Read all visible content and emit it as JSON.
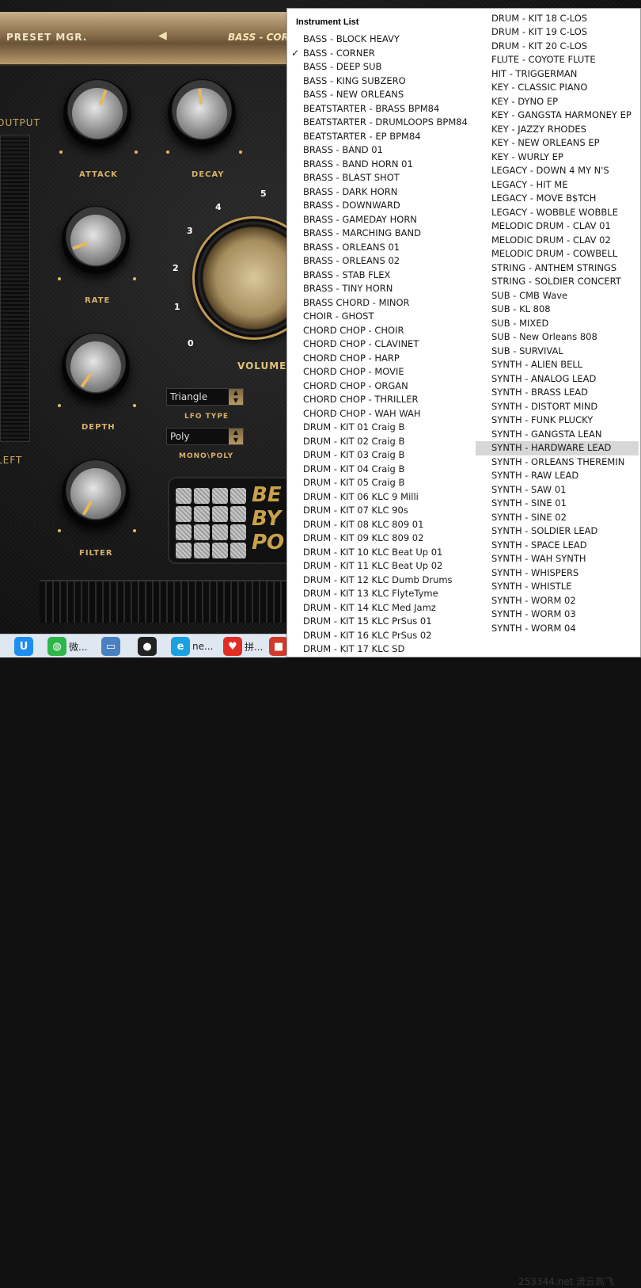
{
  "plugin": {
    "preset_manager_label": "PRESET MGR.",
    "preset_name": "BASS - CORNER",
    "output_label": "OUTPUT",
    "left_label": "LEFT",
    "knobs": [
      {
        "id": "attack",
        "label": "ATTACK"
      },
      {
        "id": "decay",
        "label": "DECAY"
      },
      {
        "id": "rate",
        "label": "RATE"
      },
      {
        "id": "depth",
        "label": "DEPTH"
      },
      {
        "id": "filter",
        "label": "FILTER"
      }
    ],
    "volume": {
      "label": "VOLUME",
      "scale": [
        "0",
        "1",
        "2",
        "3",
        "4",
        "5"
      ]
    },
    "lfo_type": {
      "label": "LFO TYPE",
      "value": "Triangle"
    },
    "mono_poly": {
      "label": "MONO\\POLY",
      "value": "Poly"
    },
    "logo_text": [
      "BE",
      "BY",
      "PO"
    ]
  },
  "menu": {
    "title": "Instrument List",
    "checked_item": "BASS - CORNER",
    "highlighted_item": "SYNTH - HARDWARE LEAD",
    "left_column": [
      "BASS - BLOCK HEAVY",
      "BASS - CORNER",
      "BASS - DEEP SUB",
      "BASS - KING SUBZERO",
      "BASS - NEW ORLEANS",
      "BEATSTARTER - BRASS BPM84",
      "BEATSTARTER - DRUMLOOPS BPM84",
      "BEATSTARTER - EP BPM84",
      "BRASS - BAND 01",
      "BRASS - BAND HORN 01",
      "BRASS - BLAST SHOT",
      "BRASS - DARK HORN",
      "BRASS - DOWNWARD",
      "BRASS - GAMEDAY HORN",
      "BRASS - MARCHING BAND",
      "BRASS - ORLEANS 01",
      "BRASS - ORLEANS 02",
      "BRASS - STAB FLEX",
      "BRASS - TINY HORN",
      "BRASS CHORD - MINOR",
      "CHOIR - GHOST",
      "CHORD CHOP - CHOIR",
      "CHORD CHOP - CLAVINET",
      "CHORD CHOP - HARP",
      "CHORD CHOP - MOVIE",
      "CHORD CHOP - ORGAN",
      "CHORD CHOP - THRILLER",
      "CHORD CHOP - WAH WAH",
      "DRUM - KIT 01 Craig B",
      "DRUM - KIT 02 Craig B",
      "DRUM - KIT 03 Craig B",
      "DRUM - KIT 04 Craig B",
      "DRUM - KIT 05 Craig B",
      "DRUM - KIT 06 KLC 9 Milli",
      "DRUM - KIT 07 KLC 90s",
      "DRUM - KIT 08 KLC 809 01",
      "DRUM - KIT 09 KLC 809 02",
      "DRUM - KIT 10 KLC Beat Up 01",
      "DRUM - KIT 11 KLC Beat Up 02",
      "DRUM - KIT 12 KLC Dumb Drums",
      "DRUM - KIT 13 KLC FlyteTyme",
      "DRUM - KIT 14 KLC Med Jamz",
      "DRUM - KIT 15 KLC PrSus 01",
      "DRUM - KIT 16 KLC PrSus 02",
      "DRUM - KIT 17 KLC SD"
    ],
    "right_column": [
      "DRUM - KIT 18 C-LOS",
      "DRUM - KIT 19 C-LOS",
      "DRUM - KIT 20 C-LOS",
      "FLUTE - COYOTE FLUTE",
      "HIT - TRIGGERMAN",
      "KEY - CLASSIC PIANO",
      "KEY - DYNO EP",
      "KEY - GANGSTA HARMONEY EP",
      "KEY - JAZZY RHODES",
      "KEY - NEW ORLEANS EP",
      "KEY - WURLY EP",
      "LEGACY - DOWN 4 MY N'S",
      "LEGACY - HIT ME",
      "LEGACY - MOVE B$TCH",
      "LEGACY - WOBBLE WOBBLE",
      "MELODIC DRUM - CLAV 01",
      "MELODIC DRUM - CLAV 02",
      "MELODIC DRUM - COWBELL",
      "STRING - ANTHEM STRINGS",
      "STRING - SOLDIER CONCERT",
      "SUB - CMB Wave",
      "SUB - KL 808",
      "SUB - MIXED",
      "SUB - New Orleans 808",
      "SUB - SURVIVAL",
      "SYNTH - ALIEN BELL",
      "SYNTH - ANALOG LEAD",
      "SYNTH - BRASS LEAD",
      "SYNTH - DISTORT MIND",
      "SYNTH - FUNK PLUCKY",
      "SYNTH - GANGSTA LEAN",
      "SYNTH - HARDWARE LEAD",
      "SYNTH - ORLEANS THEREMIN",
      "SYNTH - RAW LEAD",
      "SYNTH - SAW 01",
      "SYNTH - SINE 01",
      "SYNTH - SINE 02",
      "SYNTH - SOLDIER LEAD",
      "SYNTH - SPACE LEAD",
      "SYNTH - WAH SYNTH",
      "SYNTH - WHISPERS",
      "SYNTH - WHISTLE",
      "SYNTH - WORM 02",
      "SYNTH - WORM 03",
      "SYNTH - WORM 04"
    ]
  },
  "taskbar": {
    "items": [
      {
        "icon": "qq-browser-icon",
        "label": ""
      },
      {
        "icon": "wechat-icon",
        "label": "微..."
      },
      {
        "icon": "computer-icon",
        "label": ""
      },
      {
        "icon": "qq-penguin-icon",
        "label": ""
      },
      {
        "icon": "edge-icon",
        "label": "ne..."
      },
      {
        "icon": "pinduoduo-icon",
        "label": "拼..."
      },
      {
        "icon": "app-icon",
        "label": ""
      }
    ],
    "watermark": "253344.net 流云高飞"
  },
  "colors": {
    "accent_gold": "#e7b85a",
    "menu_highlight": "#d7d7d7"
  }
}
